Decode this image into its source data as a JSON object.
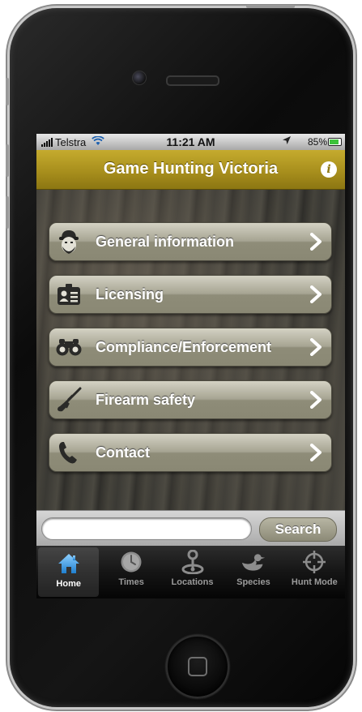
{
  "status_bar": {
    "carrier": "Telstra",
    "time": "11:21 AM",
    "battery": "85%",
    "battery_level": 0.85
  },
  "header": {
    "title": "Game Hunting Victoria",
    "info_glyph": "i"
  },
  "menu": {
    "items": [
      {
        "label": "General information",
        "icon": "hunter-face-icon"
      },
      {
        "label": "Licensing",
        "icon": "id-card-icon"
      },
      {
        "label": "Compliance/Enforcement",
        "icon": "binoculars-icon"
      },
      {
        "label": "Firearm safety",
        "icon": "rifle-icon"
      },
      {
        "label": "Contact",
        "icon": "phone-icon"
      }
    ]
  },
  "search": {
    "placeholder": "",
    "value": "",
    "button_label": "Search"
  },
  "tab_bar": {
    "tabs": [
      {
        "label": "Home",
        "icon": "house-icon",
        "active": true
      },
      {
        "label": "Times",
        "icon": "clock-icon",
        "active": false
      },
      {
        "label": "Locations",
        "icon": "map-pin-icon",
        "active": false
      },
      {
        "label": "Species",
        "icon": "duck-icon",
        "active": false
      },
      {
        "label": "Hunt Mode",
        "icon": "crosshair-icon",
        "active": false
      }
    ]
  },
  "colors": {
    "title_bar": "#a88f1d",
    "button_face": "#a6a492",
    "tab_active_icon": "#4aa8e8",
    "tab_inactive_icon": "#8c8c8c"
  }
}
